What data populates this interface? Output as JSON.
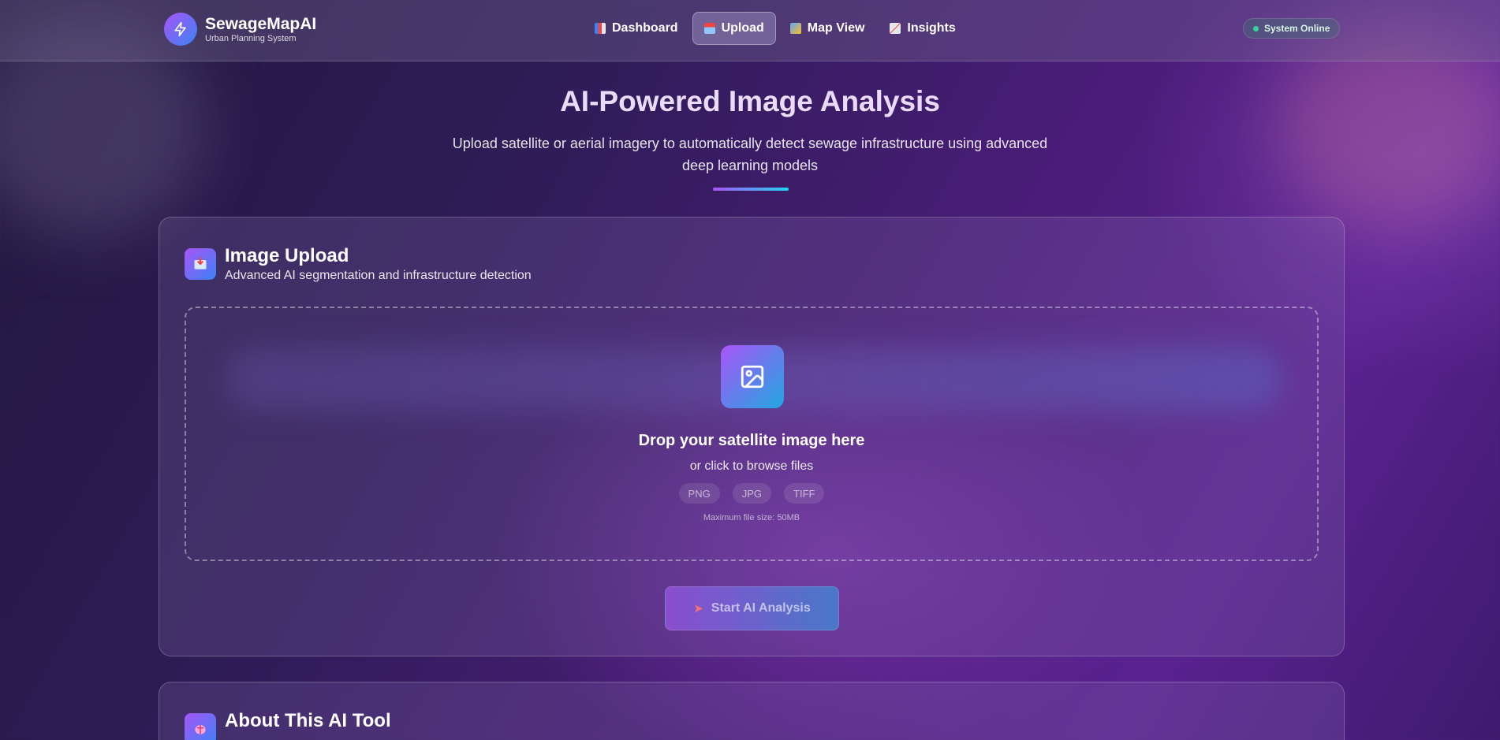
{
  "brand": {
    "name": "SewageMapAI",
    "subtitle": "Urban Planning System",
    "logo_icon": "lightning-bolt-icon"
  },
  "nav": {
    "items": [
      {
        "label": "Dashboard",
        "icon": "bar-chart-icon",
        "active": false
      },
      {
        "label": "Upload",
        "icon": "inbox-tray-icon",
        "active": true
      },
      {
        "label": "Map View",
        "icon": "map-icon",
        "active": false
      },
      {
        "label": "Insights",
        "icon": "trending-chart-icon",
        "active": false
      }
    ]
  },
  "status": {
    "label": "System Online",
    "color": "#34d399"
  },
  "hero": {
    "title": "AI-Powered Image Analysis",
    "subtitle": "Upload satellite or aerial imagery to automatically detect sewage infrastructure using advanced deep learning models"
  },
  "upload_card": {
    "title": "Image Upload",
    "description": "Advanced AI segmentation and infrastructure detection",
    "dropzone": {
      "title": "Drop your satellite image here",
      "subtitle": "or click to browse files",
      "formats": [
        "PNG",
        "JPG",
        "TIFF"
      ],
      "max_size": "Maximum file size: 50MB"
    },
    "start_button": "Start AI Analysis"
  },
  "about_card": {
    "title": "About This AI Tool"
  },
  "colors": {
    "accent_purple": "#a855f7",
    "accent_cyan": "#22d3ee",
    "accent_blue": "#3b82f6"
  }
}
